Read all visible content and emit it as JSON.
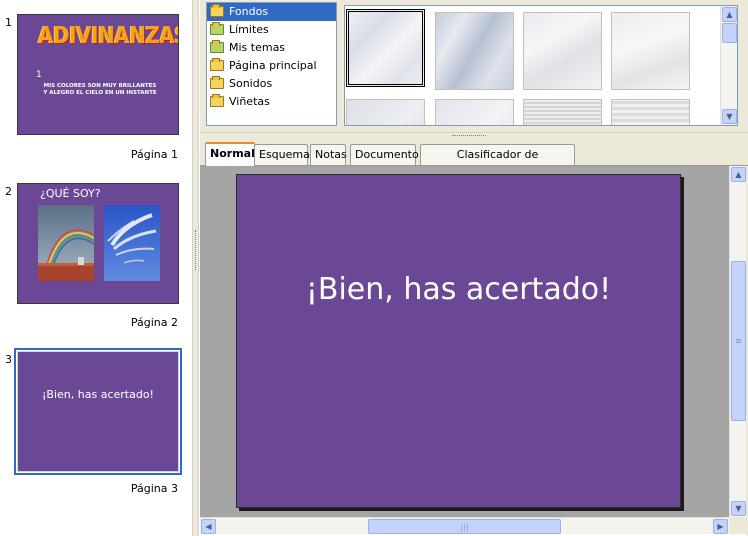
{
  "slides": [
    {
      "number": "1",
      "page_label": "Página 1",
      "title": "ADIVINANZAS",
      "item_number": "1",
      "body_lines": [
        "MIS COLORES SON MUY BRILLANTES",
        "Y ALEGRO EL CIELO EN UN INSTANTE"
      ]
    },
    {
      "number": "2",
      "page_label": "Página 2",
      "title": "¿QUÉ SOY?"
    },
    {
      "number": "3",
      "page_label": "Página 3",
      "text": "¡Bien, has acertado!"
    }
  ],
  "gallery": {
    "themes": [
      {
        "label": "Fondos",
        "selected": true
      },
      {
        "label": "Límites",
        "selected": false
      },
      {
        "label": "Mis temas",
        "selected": false
      },
      {
        "label": "Página principal",
        "selected": false
      },
      {
        "label": "Sonidos",
        "selected": false
      },
      {
        "label": "Viñetas",
        "selected": false
      }
    ]
  },
  "tabs": [
    {
      "label": "Normal",
      "active": true
    },
    {
      "label": "Esquema",
      "active": false
    },
    {
      "label": "Notas",
      "active": false
    },
    {
      "label": "Documento",
      "active": false
    },
    {
      "label": "Clasificador de diapositivas",
      "active": false
    }
  ],
  "main_slide": {
    "text": "¡Bien, has acertado!"
  },
  "colors": {
    "slide_background": "#6b4896",
    "selection": "#316ac5",
    "title_orange": "#f3a21b"
  },
  "icons": {
    "theme_folder": "folder-icon",
    "scroll_up": "arrow-up-icon",
    "scroll_down": "arrow-down-icon",
    "scroll_left": "arrow-left-icon",
    "scroll_right": "arrow-right-icon"
  }
}
